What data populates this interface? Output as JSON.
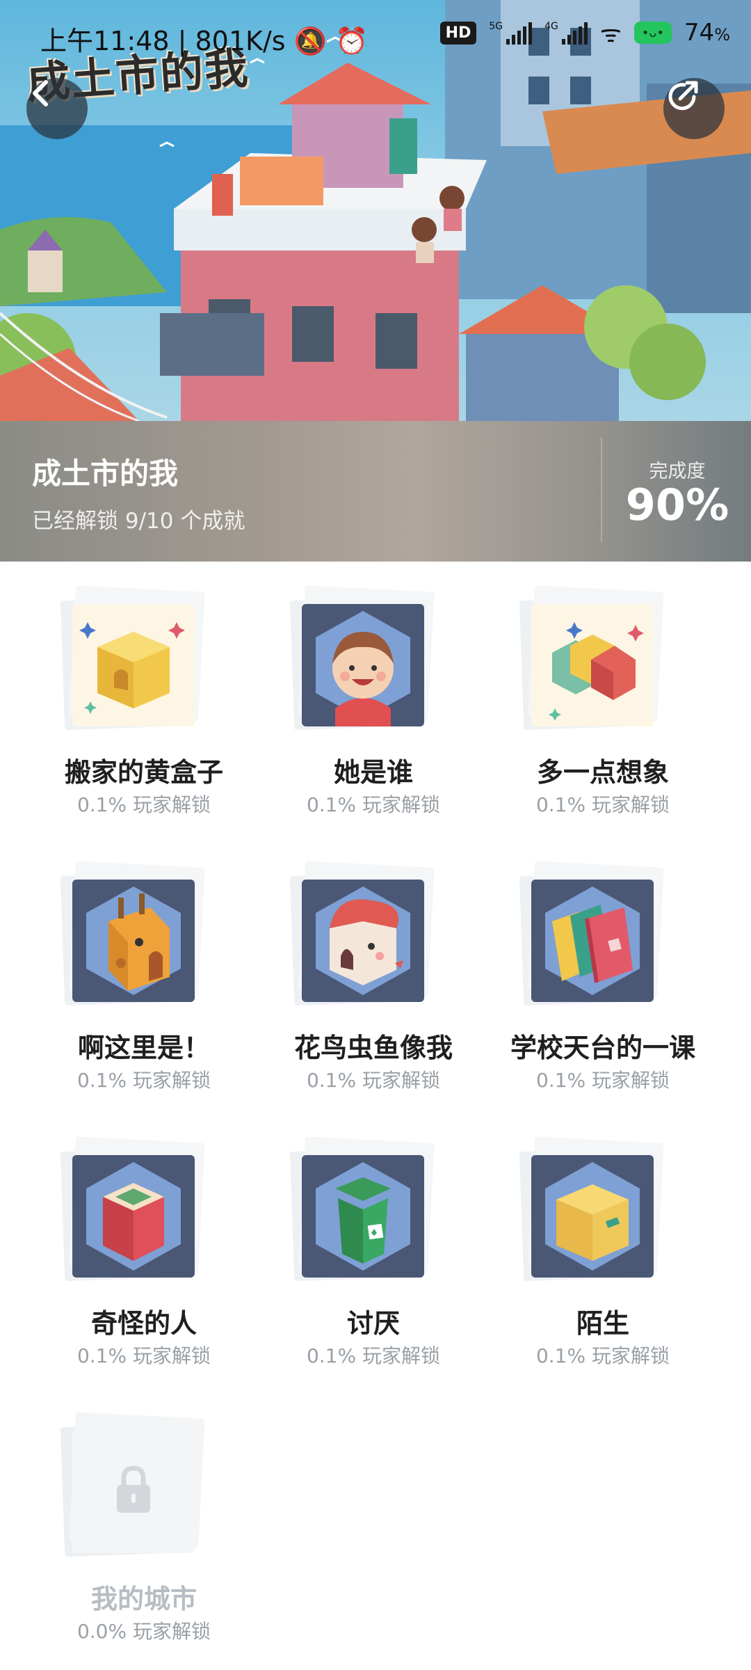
{
  "status_bar": {
    "time": "上午11:48",
    "speed": "801K/s",
    "hd_badge": "HD",
    "net_5g": "5G",
    "net_4g": "4G",
    "battery_percent": "74",
    "battery_unit": "%"
  },
  "hero": {
    "game_logo_text": "成土市的我",
    "back_icon": "chevron-left-icon",
    "share_icon": "share-icon"
  },
  "banner": {
    "title": "成土市的我",
    "subtitle": "已经解锁 9/10 个成就",
    "progress_label": "完成度",
    "progress_value": "90%"
  },
  "achievements": [
    {
      "name": "搬家的黄盒子",
      "rate": "0.1% 玩家解锁",
      "icon": "yellow-box-icon",
      "locked": false
    },
    {
      "name": "她是谁",
      "rate": "0.1% 玩家解锁",
      "icon": "girl-face-icon",
      "locked": false
    },
    {
      "name": "多一点想象",
      "rate": "0.1% 玩家解锁",
      "icon": "colorful-blocks-icon",
      "locked": false
    },
    {
      "name": "啊这里是！",
      "rate": "0.1% 玩家解锁",
      "icon": "giraffe-house-icon",
      "locked": false
    },
    {
      "name": "花鸟虫鱼像我",
      "rate": "0.1% 玩家解锁",
      "icon": "bird-house-icon",
      "locked": false
    },
    {
      "name": "学校天台的一课",
      "rate": "0.1% 玩家解锁",
      "icon": "books-icon",
      "locked": false
    },
    {
      "name": "奇怪的人",
      "rate": "0.1% 玩家解锁",
      "icon": "red-box-icon",
      "locked": false
    },
    {
      "name": "讨厌",
      "rate": "0.1% 玩家解锁",
      "icon": "trash-bin-icon",
      "locked": false
    },
    {
      "name": "陌生",
      "rate": "0.1% 玩家解锁",
      "icon": "cardboard-box-icon",
      "locked": false
    },
    {
      "name": "我的城市",
      "rate": "0.0% 玩家解锁",
      "icon": "lock-icon",
      "locked": true
    }
  ],
  "colors": {
    "badge_frame": "#4a5775",
    "badge_hex": "#7ea0d4",
    "locked_text": "#b7bdc3",
    "rate_text": "#9aa0a6"
  }
}
